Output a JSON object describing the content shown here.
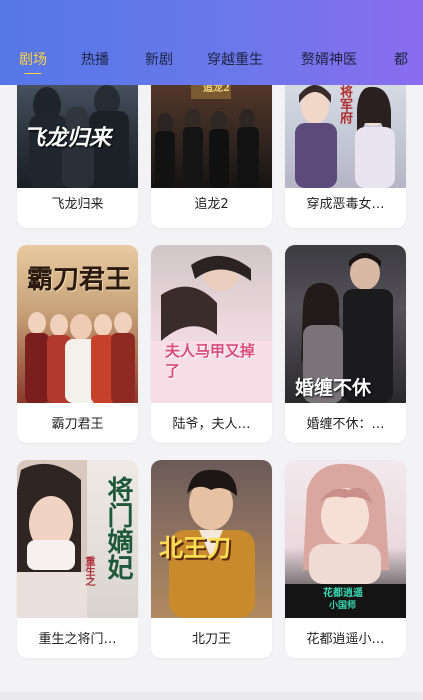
{
  "tabs": [
    {
      "label": "剧场",
      "active": true
    },
    {
      "label": "热播",
      "active": false
    },
    {
      "label": "新剧",
      "active": false
    },
    {
      "label": "穿越重生",
      "active": false
    },
    {
      "label": "赘婿神医",
      "active": false
    },
    {
      "label": "都",
      "active": false
    }
  ],
  "cards": [
    {
      "title": "飞龙归来",
      "poster_text": "飞龙归来"
    },
    {
      "title": "追龙2",
      "poster_text": "追龙2"
    },
    {
      "title": "穿成恶毒女…",
      "poster_text": "将军府"
    },
    {
      "title": "霸刀君王",
      "poster_text": "霸刀君王"
    },
    {
      "title": "陆爷，夫人…",
      "poster_text": "夫人马甲又掉了"
    },
    {
      "title": "婚缠不休：…",
      "poster_text": "婚缠不休"
    },
    {
      "title": "重生之将门…",
      "poster_text": "将门嫡妃",
      "poster_subtext": "重生之"
    },
    {
      "title": "北刀王",
      "poster_text": "北王刀"
    },
    {
      "title": "花都逍遥小…",
      "poster_text": "花都逍遥",
      "poster_subtext": "小国师"
    }
  ]
}
